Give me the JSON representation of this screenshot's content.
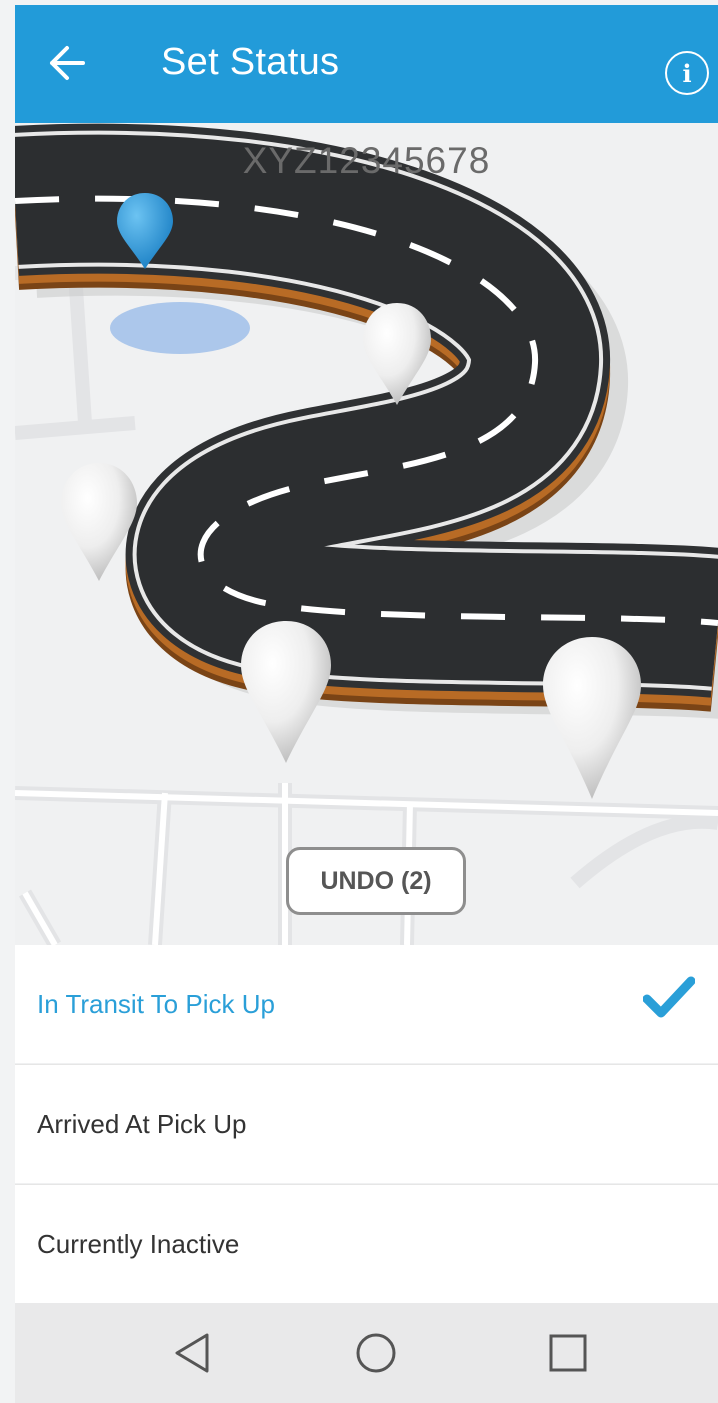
{
  "app_bar": {
    "title": "Set Status",
    "background_color": "#229bd9",
    "back_icon": "arrow-left-icon",
    "info_icon": "info-icon",
    "info_glyph": "i"
  },
  "vehicle": {
    "id": "XYZ12345678"
  },
  "undo": {
    "label": "UNDO (2)"
  },
  "statuses": [
    {
      "label": "In Transit To Pick Up",
      "selected": true,
      "color": "#2a9fd8"
    },
    {
      "label": "Arrived At Pick Up",
      "selected": false
    },
    {
      "label": "Currently Inactive",
      "selected": false
    }
  ],
  "selected_icon": "checkmark-icon",
  "nav_bar": {
    "back_icon": "triangle-back-icon",
    "home_icon": "circle-home-icon",
    "recents_icon": "square-recents-icon"
  }
}
